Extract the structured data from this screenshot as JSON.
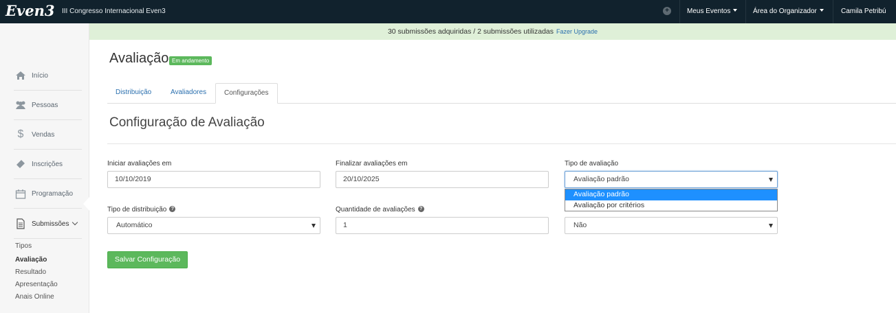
{
  "topbar": {
    "brand": "Even3",
    "event_name": "III Congresso Internacional Even3",
    "menu": [
      {
        "label": "Meus Eventos"
      },
      {
        "label": "Área do Organizador"
      },
      {
        "label": "Camila Petribú"
      }
    ]
  },
  "banner": {
    "text": "30 submissões adquiridas / 2 submissões utilizadas",
    "link": "Fazer Upgrade"
  },
  "sidebar": {
    "items": [
      {
        "label": "Início",
        "icon": "home-icon"
      },
      {
        "label": "Pessoas",
        "icon": "people-icon"
      },
      {
        "label": "Vendas",
        "icon": "dollar-icon"
      },
      {
        "label": "Inscrições",
        "icon": "ticket-icon"
      },
      {
        "label": "Programação",
        "icon": "calendar-icon"
      },
      {
        "label": "Submissões",
        "icon": "document-icon"
      }
    ],
    "sub_items": [
      {
        "label": "Tipos"
      },
      {
        "label": "Avaliação"
      },
      {
        "label": "Resultado"
      },
      {
        "label": "Apresentação"
      },
      {
        "label": "Anais Online"
      }
    ]
  },
  "page": {
    "title": "Avaliação",
    "status": "Em andamento",
    "tabs": [
      {
        "label": "Distribuição"
      },
      {
        "label": "Avaliadores"
      },
      {
        "label": "Configurações"
      }
    ],
    "section_title": "Configuração de Avaliação"
  },
  "form": {
    "start": {
      "label": "Iniciar avaliações em",
      "value": "10/10/2019"
    },
    "end": {
      "label": "Finalizar avaliações em",
      "value": "20/10/2025"
    },
    "type": {
      "label": "Tipo de avaliação",
      "value": "Avaliação padrão",
      "options": [
        "Avaliação padrão",
        "Avaliação por critérios"
      ]
    },
    "distribution": {
      "label": "Tipo de distribuição",
      "value": "Automático"
    },
    "quantity": {
      "label": "Quantidade de avaliações",
      "value": "1"
    },
    "third": {
      "value": "Não"
    },
    "save_label": "Salvar Configuração"
  }
}
